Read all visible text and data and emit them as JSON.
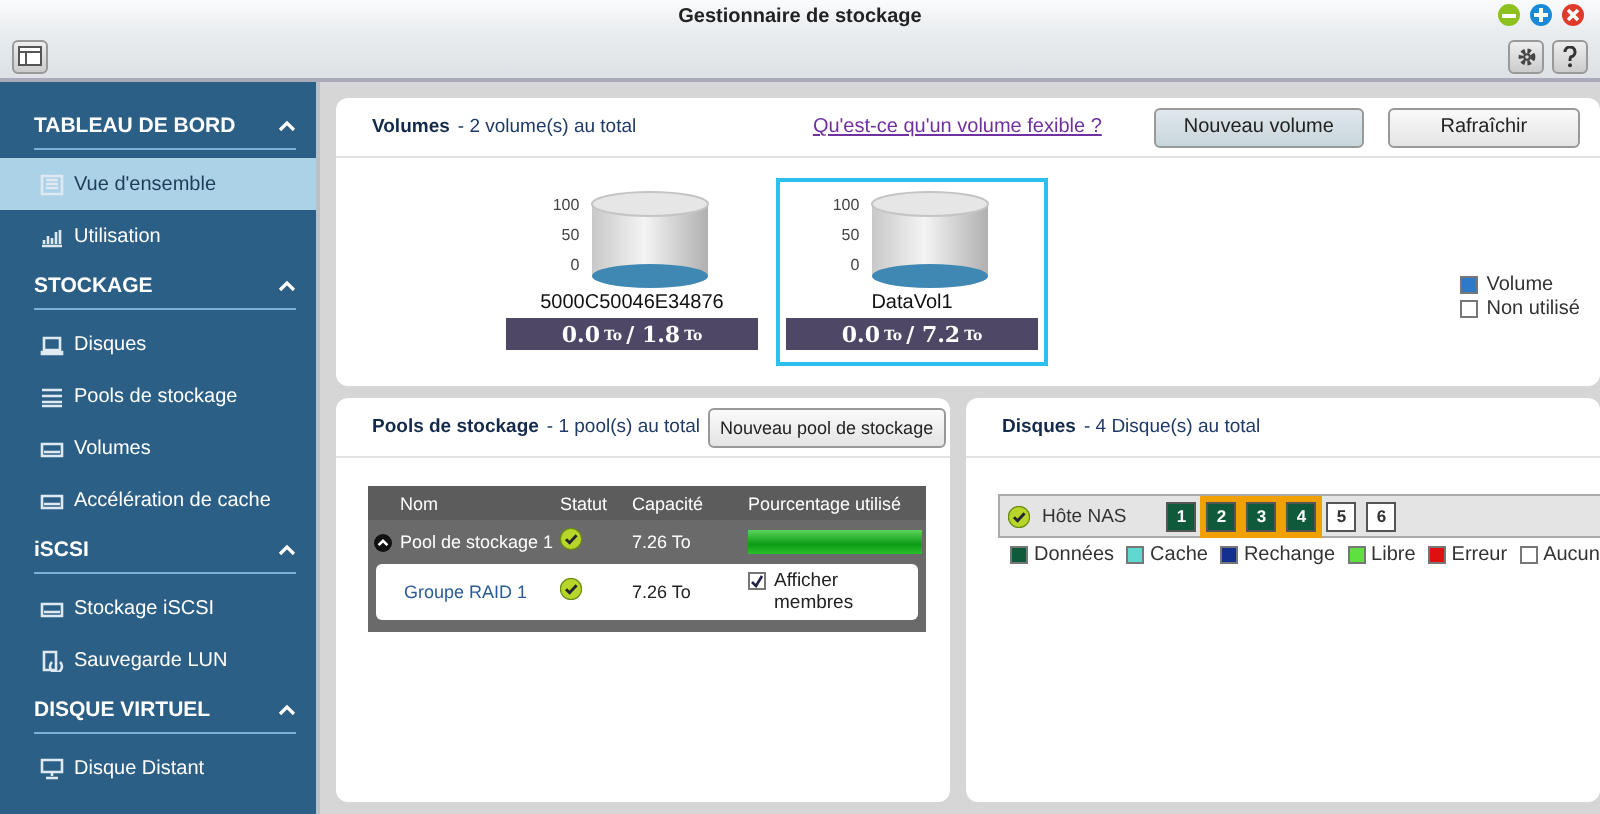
{
  "window": {
    "title": "Gestionnaire de stockage"
  },
  "sidebar": [
    {
      "title": "TABLEAU DE BORD",
      "expanded": true,
      "items": [
        {
          "label": "Vue d'ensemble",
          "selected": true
        },
        {
          "label": "Utilisation",
          "selected": false
        }
      ]
    },
    {
      "title": "STOCKAGE",
      "expanded": true,
      "items": [
        {
          "label": "Disques",
          "selected": false
        },
        {
          "label": "Pools de stockage",
          "selected": false
        },
        {
          "label": "Volumes",
          "selected": false
        },
        {
          "label": "Accélération de cache",
          "selected": false
        }
      ]
    },
    {
      "title": "iSCSI",
      "expanded": true,
      "items": [
        {
          "label": "Stockage iSCSI",
          "selected": false
        },
        {
          "label": "Sauvegarde LUN",
          "selected": false
        }
      ]
    },
    {
      "title": "DISQUE VIRTUEL",
      "expanded": true,
      "items": [
        {
          "label": "Disque Distant",
          "selected": false
        }
      ]
    }
  ],
  "volumes": {
    "title": "Volumes",
    "count": "- 2 volume(s) au total",
    "link": "Qu'est-ce qu'un volume fexible ?",
    "buttons": [
      {
        "label": "Nouveau volume",
        "primary": true
      },
      {
        "label": "Rafraîchir",
        "primary": false
      }
    ],
    "items": [
      {
        "name": "5000C50046E34876",
        "ticks": [
          "100",
          "50",
          "0"
        ],
        "used": "0.0",
        "used_unit": "To",
        "separator": "/",
        "total": "1.8",
        "total_unit": "To",
        "selected": false
      },
      {
        "name": "DataVol1",
        "ticks": [
          "100",
          "50",
          "0"
        ],
        "used": "0.0",
        "used_unit": "To",
        "separator": "/",
        "total": "7.2",
        "total_unit": "To",
        "selected": true
      }
    ],
    "legend": [
      {
        "label": "Volume",
        "color": "#2f7ac8"
      },
      {
        "label": "Non utilisé",
        "color": "#ffffff"
      }
    ]
  },
  "pools": {
    "title": "Pools de stockage",
    "count": "- 1 pool(s) au total",
    "button": "Nouveau pool de stockage",
    "columns": [
      "Nom",
      "Statut",
      "Capacité",
      "Pourcentage utilisé"
    ],
    "pool": {
      "name": "Pool de stockage 1",
      "expanded": true,
      "ok": true,
      "capacity": "7.26 To",
      "level": 1
    },
    "group": {
      "name": "Groupe RAID 1",
      "ok": true,
      "capacity": "7.26 To",
      "checkbox": {
        "label": "Afficher membres",
        "checked": true
      }
    }
  },
  "disks": {
    "title": "Disques",
    "count": "- 4 Disque(s) au total",
    "host": {
      "label": "Hôte NAS",
      "ok": true
    },
    "slots": [
      {
        "label": "1",
        "kind": "data",
        "selected": false
      },
      {
        "label": "2",
        "kind": "data",
        "selected": true
      },
      {
        "label": "3",
        "kind": "data",
        "selected": true
      },
      {
        "label": "4",
        "kind": "data",
        "selected": true
      },
      {
        "label": "5",
        "kind": "none",
        "selected": false
      },
      {
        "label": "6",
        "kind": "none",
        "selected": false
      }
    ],
    "legend": [
      {
        "label": "Données",
        "color": "#0e5a3a"
      },
      {
        "label": "Cache",
        "color": "#5fd8d0"
      },
      {
        "label": "Rechange",
        "color": "#12308f"
      },
      {
        "label": "Libre",
        "color": "#5ee040"
      },
      {
        "label": "Erreur",
        "color": "#e01010"
      },
      {
        "label": "Aucun",
        "color": "#ffffff"
      }
    ]
  }
}
